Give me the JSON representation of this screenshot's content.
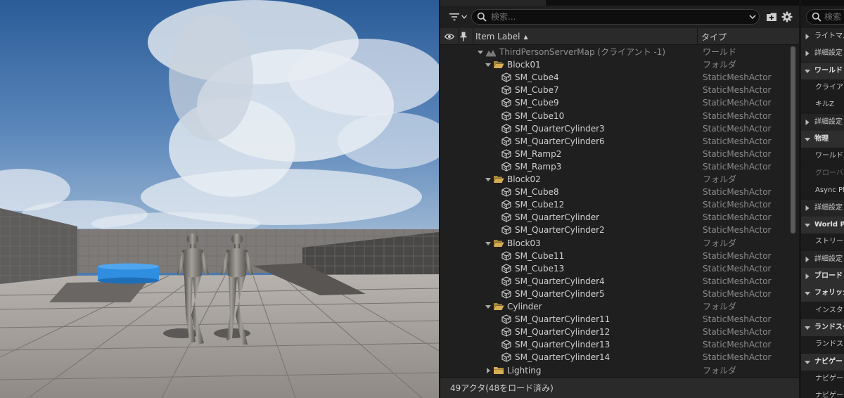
{
  "outliner": {
    "search_placeholder": "検索...",
    "columns": {
      "label": "Item Label",
      "sort_glyph": "▲",
      "type": "タイプ"
    },
    "rows": [
      {
        "label": "ThirdPersonServerMap (クライアント -1)",
        "type": "ワールド",
        "icon": "world-icon",
        "depth": 0,
        "expander": "expanded"
      },
      {
        "label": "Block01",
        "type": "フォルダ",
        "icon": "folder-open-icon",
        "depth": 1,
        "expander": "expanded"
      },
      {
        "label": "SM_Cube4",
        "type": "StaticMeshActor",
        "icon": "static-mesh-icon",
        "depth": 2
      },
      {
        "label": "SM_Cube7",
        "type": "StaticMeshActor",
        "icon": "static-mesh-icon",
        "depth": 2
      },
      {
        "label": "SM_Cube9",
        "type": "StaticMeshActor",
        "icon": "static-mesh-icon",
        "depth": 2
      },
      {
        "label": "SM_Cube10",
        "type": "StaticMeshActor",
        "icon": "static-mesh-icon",
        "depth": 2
      },
      {
        "label": "SM_QuarterCylinder3",
        "type": "StaticMeshActor",
        "icon": "static-mesh-icon",
        "depth": 2
      },
      {
        "label": "SM_QuarterCylinder6",
        "type": "StaticMeshActor",
        "icon": "static-mesh-icon",
        "depth": 2
      },
      {
        "label": "SM_Ramp2",
        "type": "StaticMeshActor",
        "icon": "static-mesh-icon",
        "depth": 2
      },
      {
        "label": "SM_Ramp3",
        "type": "StaticMeshActor",
        "icon": "static-mesh-icon",
        "depth": 2
      },
      {
        "label": "Block02",
        "type": "フォルダ",
        "icon": "folder-open-icon",
        "depth": 1,
        "expander": "expanded"
      },
      {
        "label": "SM_Cube8",
        "type": "StaticMeshActor",
        "icon": "static-mesh-icon",
        "depth": 2
      },
      {
        "label": "SM_Cube12",
        "type": "StaticMeshActor",
        "icon": "static-mesh-icon",
        "depth": 2
      },
      {
        "label": "SM_QuarterCylinder",
        "type": "StaticMeshActor",
        "icon": "static-mesh-icon",
        "depth": 2
      },
      {
        "label": "SM_QuarterCylinder2",
        "type": "StaticMeshActor",
        "icon": "static-mesh-icon",
        "depth": 2
      },
      {
        "label": "Block03",
        "type": "フォルダ",
        "icon": "folder-open-icon",
        "depth": 1,
        "expander": "expanded"
      },
      {
        "label": "SM_Cube11",
        "type": "StaticMeshActor",
        "icon": "static-mesh-icon",
        "depth": 2
      },
      {
        "label": "SM_Cube13",
        "type": "StaticMeshActor",
        "icon": "static-mesh-icon",
        "depth": 2
      },
      {
        "label": "SM_QuarterCylinder4",
        "type": "StaticMeshActor",
        "icon": "static-mesh-icon",
        "depth": 2
      },
      {
        "label": "SM_QuarterCylinder5",
        "type": "StaticMeshActor",
        "icon": "static-mesh-icon",
        "depth": 2
      },
      {
        "label": "Cylinder",
        "type": "フォルダ",
        "icon": "folder-open-icon",
        "depth": 1,
        "expander": "expanded"
      },
      {
        "label": "SM_QuarterCylinder11",
        "type": "StaticMeshActor",
        "icon": "static-mesh-icon",
        "depth": 2
      },
      {
        "label": "SM_QuarterCylinder12",
        "type": "StaticMeshActor",
        "icon": "static-mesh-icon",
        "depth": 2
      },
      {
        "label": "SM_QuarterCylinder13",
        "type": "StaticMeshActor",
        "icon": "static-mesh-icon",
        "depth": 2
      },
      {
        "label": "SM_QuarterCylinder14",
        "type": "StaticMeshActor",
        "icon": "static-mesh-icon",
        "depth": 2
      },
      {
        "label": "Lighting",
        "type": "フォルダ",
        "icon": "folder-closed-icon",
        "depth": 1,
        "expander": "collapsed"
      }
    ],
    "status": "49アクタ(48をロード済み)"
  },
  "details": {
    "search_placeholder": "検索",
    "rows": [
      {
        "label": "ライトマス",
        "kind": "sub",
        "arrow": "collapsed"
      },
      {
        "label": "詳細設定",
        "kind": "sub",
        "arrow": "collapsed"
      },
      {
        "label": "ワールド",
        "kind": "section",
        "arrow": "expanded"
      },
      {
        "label": "クライアン",
        "kind": "prop",
        "arrow": "none"
      },
      {
        "label": "キルZ",
        "kind": "prop",
        "arrow": "none"
      },
      {
        "label": "詳細設定",
        "kind": "sub",
        "arrow": "collapsed"
      },
      {
        "label": "物理",
        "kind": "section",
        "arrow": "expanded"
      },
      {
        "label": "ワールド重",
        "kind": "prop",
        "arrow": "none"
      },
      {
        "label": "グローバル",
        "kind": "prop-dim",
        "arrow": "none"
      },
      {
        "label": "Async Ph",
        "kind": "prop",
        "arrow": "none"
      },
      {
        "label": "詳細設定",
        "kind": "sub",
        "arrow": "collapsed"
      },
      {
        "label": "World Pa",
        "kind": "section",
        "arrow": "expanded"
      },
      {
        "label": "ストリーミ",
        "kind": "prop",
        "arrow": "none"
      },
      {
        "label": "詳細設定",
        "kind": "sub",
        "arrow": "collapsed"
      },
      {
        "label": "ブロード",
        "kind": "section",
        "arrow": "collapsed"
      },
      {
        "label": "フォリッジ",
        "kind": "section",
        "arrow": "expanded"
      },
      {
        "label": "インスタン",
        "kind": "prop",
        "arrow": "none"
      },
      {
        "label": "ランドスケ",
        "kind": "section",
        "arrow": "expanded"
      },
      {
        "label": "ランドスケ",
        "kind": "prop",
        "arrow": "none"
      },
      {
        "label": "ナビゲー",
        "kind": "section",
        "arrow": "expanded"
      },
      {
        "label": "ナビゲー",
        "kind": "prop",
        "arrow": "none"
      },
      {
        "label": "ナビゲー",
        "kind": "prop",
        "arrow": "none"
      }
    ]
  },
  "colors": {
    "panel_bg": "#1f1f1f",
    "header_bg": "#2a2a2a",
    "text": "#d0d0d0",
    "type_text": "#8a8a8a",
    "folder": "#c9a44d",
    "sky": "#3f6fa6",
    "floor": "#a8a39e",
    "platform_blue": "#2f8ee0"
  }
}
